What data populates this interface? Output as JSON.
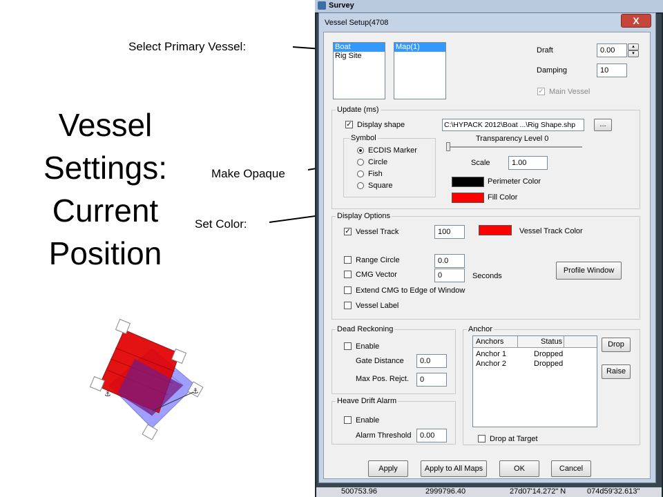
{
  "slide": {
    "title_lines": [
      "Vessel",
      "Settings:",
      "Current",
      "Position"
    ],
    "callouts": {
      "select_primary": "Select Primary Vessel:",
      "make_opaque": "Make Opaque",
      "set_color": "Set Color:"
    }
  },
  "app": {
    "title": "Survey",
    "status_row": [
      "500753.96",
      "2999796.40",
      "27d07'14.272\" N",
      "074d59'32.613\""
    ]
  },
  "dialog": {
    "title": "Vessel Setup(4708",
    "close_glyph": "X",
    "vessels": [
      "Boat",
      "Rig Site"
    ],
    "selected_vessel": "Boat",
    "maps": [
      "Map(1)"
    ],
    "draft_label": "Draft",
    "draft_value": "0.00",
    "damping_label": "Damping",
    "damping_value": "10",
    "main_vessel_label": "Main Vessel",
    "update": {
      "group_label": "Update (ms)",
      "display_shape_label": "Display shape",
      "shape_path": "C:\\HYPACK 2012\\Boat ...\\Rig Shape.shp",
      "browse_label": "...",
      "symbol_label": "Symbol",
      "symbols": [
        "ECDIS Marker",
        "Circle",
        "Fish",
        "Square"
      ],
      "selected_symbol": "ECDIS Marker",
      "transparency_label": "Transparency Level 0",
      "transparency_level": 0,
      "scale_label": "Scale",
      "scale_value": "1.00",
      "perimeter_color_label": "Perimeter Color",
      "fill_color_label": "Fill Color"
    },
    "display_options": {
      "group_label": "Display Options",
      "vessel_track_label": "Vessel Track",
      "vessel_track_value": "100",
      "vessel_track_color_label": "Vessel Track Color",
      "range_circle_label": "Range Circle",
      "range_circle_value": "0.0",
      "cmg_vector_label": "CMG Vector",
      "cmg_vector_value": "0",
      "seconds_label": "Seconds",
      "profile_window_label": "Profile Window",
      "extend_cmg_label": "Extend CMG to Edge of Window",
      "vessel_label_label": "Vessel Label"
    },
    "dead_reckoning": {
      "group_label": "Dead Reckoning",
      "enable_label": "Enable",
      "gate_distance_label": "Gate Distance",
      "gate_distance_value": "0.0",
      "max_pos_label": "Max Pos. Rejct.",
      "max_pos_value": "0"
    },
    "heave_drift": {
      "group_label": "Heave Drift Alarm",
      "enable_label": "Enable",
      "alarm_threshold_label": "Alarm Threshold",
      "alarm_threshold_value": "0.00"
    },
    "anchor": {
      "group_label": "Anchor",
      "columns": [
        "Anchors",
        "Status"
      ],
      "rows": [
        {
          "name": "Anchor 1",
          "status": "Dropped"
        },
        {
          "name": "Anchor 2",
          "status": "Dropped"
        }
      ],
      "drop_label": "Drop",
      "raise_label": "Raise",
      "drop_at_target_label": "Drop at Target"
    },
    "buttons": {
      "apply": "Apply",
      "apply_all": "Apply to All Maps",
      "ok": "OK",
      "cancel": "Cancel"
    }
  },
  "colors": {
    "perimeter": "#000000",
    "fill": "#ff0000",
    "vessel_track": "#ff0000",
    "selection": "#3399ff",
    "preview_red": "#e10000",
    "preview_blue": "#8f8fff"
  }
}
